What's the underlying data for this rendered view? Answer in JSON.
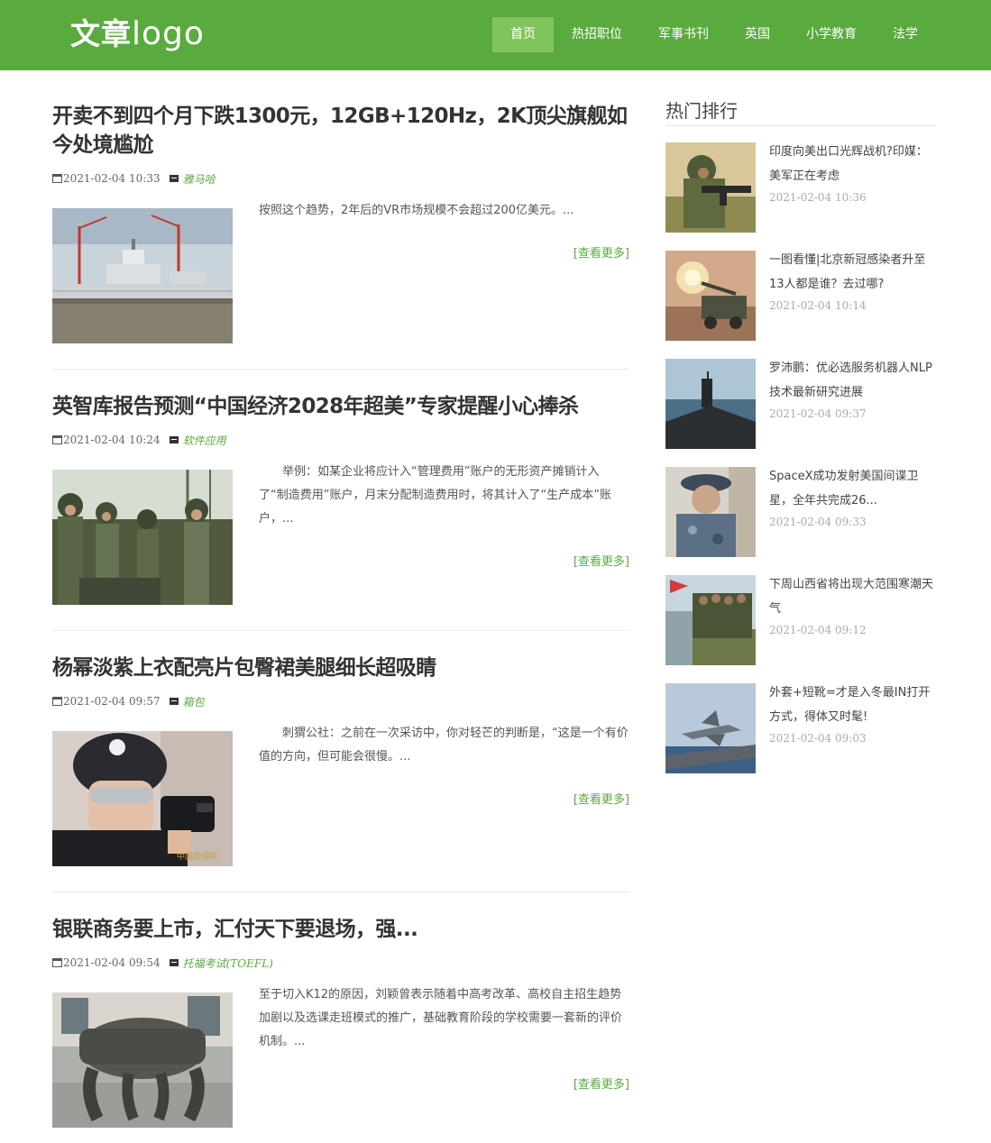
{
  "header": {
    "logo_cn": "文章",
    "logo_en": "logo",
    "nav": [
      "首页",
      "热招职位",
      "军事书刊",
      "英国",
      "小学教育",
      "法学"
    ],
    "accent": "#59ab3d",
    "active_nav": "#82c45c"
  },
  "articles": [
    {
      "title": "开卖不到四个月下跌1300元，12GB+120Hz，2K顶尖旗舰如今处境尴尬",
      "date": "2021-02-04 10:33",
      "category": "雅马哈",
      "excerpt": "按照这个趋势，2年后的VR市场规模不会超过200亿美元。...",
      "more": "[查看更多]",
      "image": "warship-image"
    },
    {
      "title": "英智库报告预测“中国经济2028年超美”专家提醒小心捧杀",
      "date": "2021-02-04 10:24",
      "category": "软件应用",
      "excerpt": "　　举例：如某企业将应计入“管理费用”账户的无形资产摊销计入了“制造费用”账户，月末分配制造费用时，将其计入了“生产成本”账户，...",
      "more": "[查看更多]",
      "image": "soldiers-image"
    },
    {
      "title": "杨幂淡紫上衣配亮片包臀裙美腿细长超吸睛",
      "date": "2021-02-04 09:57",
      "category": "箱包",
      "excerpt": "　　刺猬公社：之前在一次采访中，你对轻芒的判断是，“这是一个有价值的方向，但可能会很慢。...",
      "more": "[查看更多]",
      "image": "police-woman-image"
    },
    {
      "title": "银联商务要上市，汇付天下要退场，强...",
      "date": "2021-02-04 09:54",
      "category": "托福考试(TOEFL)",
      "excerpt": "至于切入K12的原因，刘颖曾表示随着中高考改革、高校自主招生趋势加剧以及选课走班模式的推广，基础教育阶段的学校需要一套新的评价机制。...",
      "more": "[查看更多]",
      "image": "robot-dog-image"
    }
  ],
  "sidebar": {
    "title": "热门排行",
    "items": [
      {
        "title": "印度向美出口光辉战机?印媒：美军正在考虑",
        "date": "2021-02-04 10:36",
        "image": "soldier-rifle-image"
      },
      {
        "title": "一图看懂|北京新冠感染者升至13人都是谁？去过哪?",
        "date": "2021-02-04 10:14",
        "image": "artillery-image"
      },
      {
        "title": "罗沛鹏：优必选服务机器人NLP技术最新研究进展",
        "date": "2021-02-04 09:37",
        "image": "submarine-image"
      },
      {
        "title": "SpaceX成功发射美国间谍卫星，全年共完成26...",
        "date": "2021-02-04 09:33",
        "image": "naval-officer-image"
      },
      {
        "title": "下周山西省将出现大范围寒潮天气",
        "date": "2021-02-04 09:12",
        "image": "military-truck-image"
      },
      {
        "title": "外套+短靴=才是入冬最IN打开方式，得体又时髦!",
        "date": "2021-02-04 09:03",
        "image": "jet-carrier-image"
      }
    ]
  }
}
